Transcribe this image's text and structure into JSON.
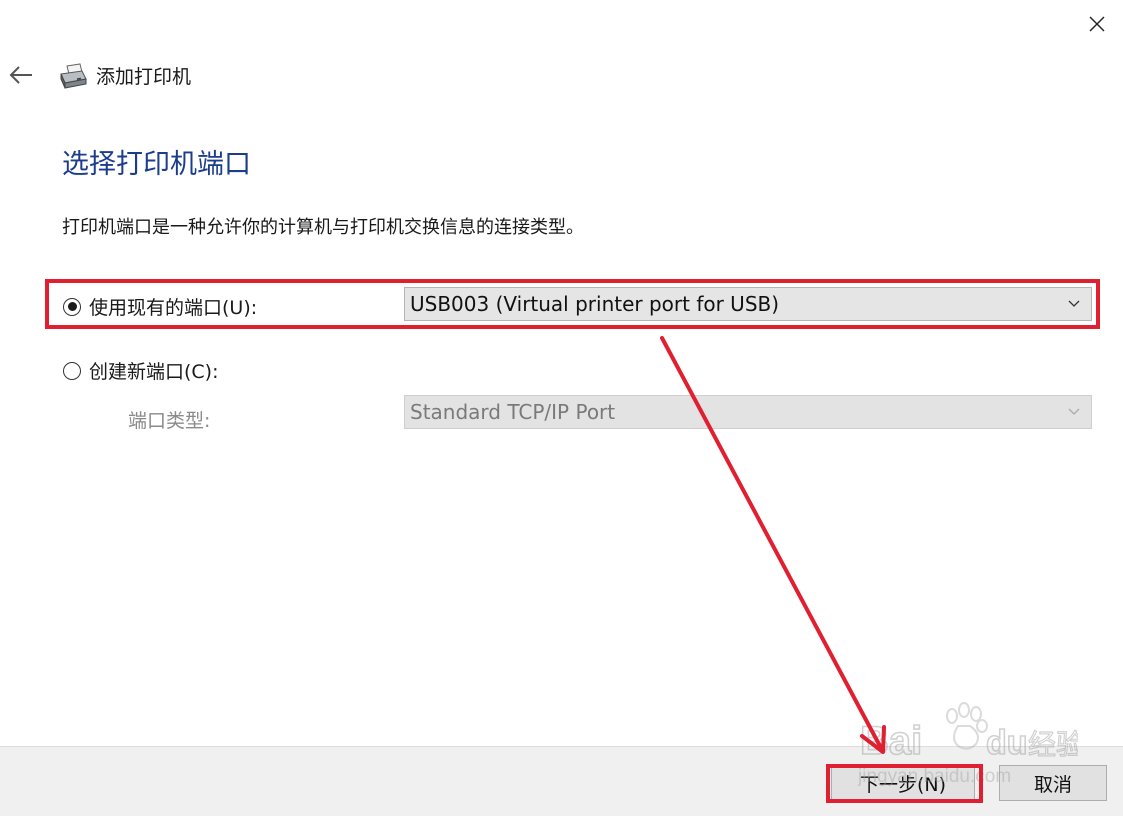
{
  "window": {
    "title": "添加打印机",
    "close_icon": "close-icon",
    "back_icon": "back-arrow-icon",
    "printer_icon": "printer-icon"
  },
  "page": {
    "heading": "选择打印机端口",
    "description": "打印机端口是一种允许你的计算机与打印机交换信息的连接类型。"
  },
  "options": {
    "use_existing": {
      "label": "使用现有的端口(U):",
      "selected": true,
      "value": "USB003 (Virtual printer port for USB)"
    },
    "create_new": {
      "label": "创建新端口(C):",
      "selected": false,
      "port_type_label": "端口类型:",
      "port_type_value": "Standard TCP/IP Port"
    }
  },
  "footer": {
    "next_label": "下一步(N)",
    "cancel_label": "取消"
  },
  "annotation": {
    "color": "#e02030"
  },
  "watermark": {
    "text": "Bai du 经验",
    "subtext": "jingyan.baidu.com"
  }
}
